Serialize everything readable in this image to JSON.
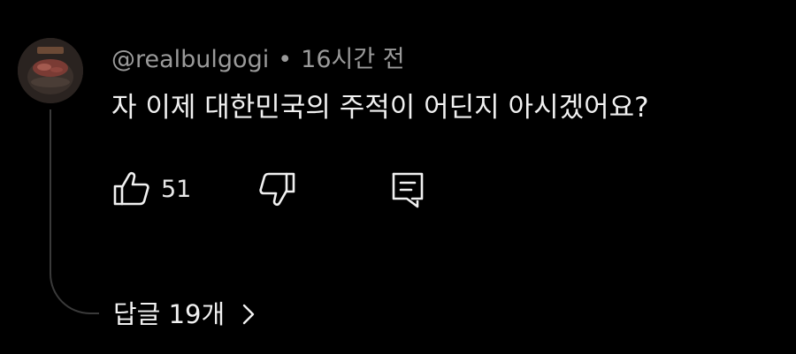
{
  "comment": {
    "username": "@realbulgogi",
    "separator": "•",
    "time": "16시간 전",
    "text": "자 이제 대한민국의 주적이 어딘지 아시겠어요?",
    "like_count": "51"
  },
  "replies": {
    "label": "답글 19개"
  },
  "icons": {
    "like": "thumbs-up-icon",
    "dislike": "thumbs-down-icon",
    "reply": "comment-reply-icon",
    "more": "chevron-right-icon"
  },
  "colors": {
    "background": "#000000",
    "text": "#f1f1f1",
    "meta": "#9a9a9a",
    "thread_line": "#3a3a3a"
  }
}
